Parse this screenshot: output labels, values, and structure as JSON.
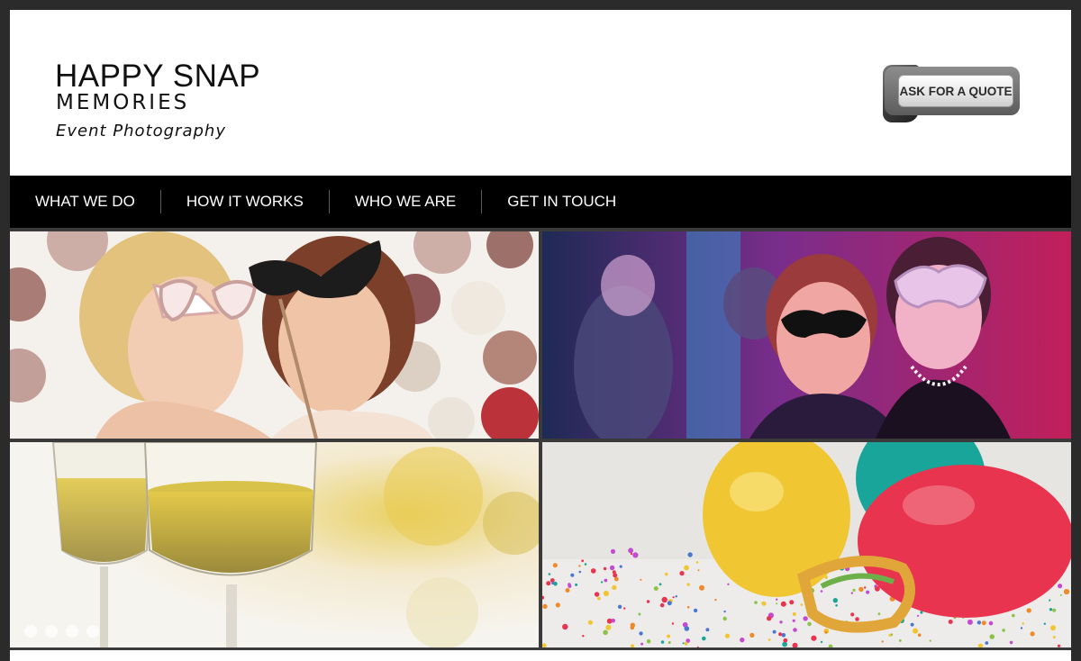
{
  "brand": {
    "line1": "HAPPY SNAP",
    "line2": "MEMORIES",
    "line3": "Event Photography"
  },
  "cta": {
    "label": "ASK FOR A QUOTE"
  },
  "nav": {
    "items": [
      {
        "label": "WHAT WE DO"
      },
      {
        "label": "HOW IT WORKS"
      },
      {
        "label": "WHO WE ARE"
      },
      {
        "label": "GET IN TOUCH"
      }
    ]
  },
  "gallery": {
    "tiles": [
      {
        "subject": "two women with photo booth props"
      },
      {
        "subject": "masquerade party guests"
      },
      {
        "subject": "champagne glasses"
      },
      {
        "subject": "balloons and confetti"
      }
    ],
    "slide_count": 4
  },
  "colors": {
    "page_background": "#2b2b2b",
    "nav_background": "#000000",
    "nav_text": "#ffffff"
  }
}
